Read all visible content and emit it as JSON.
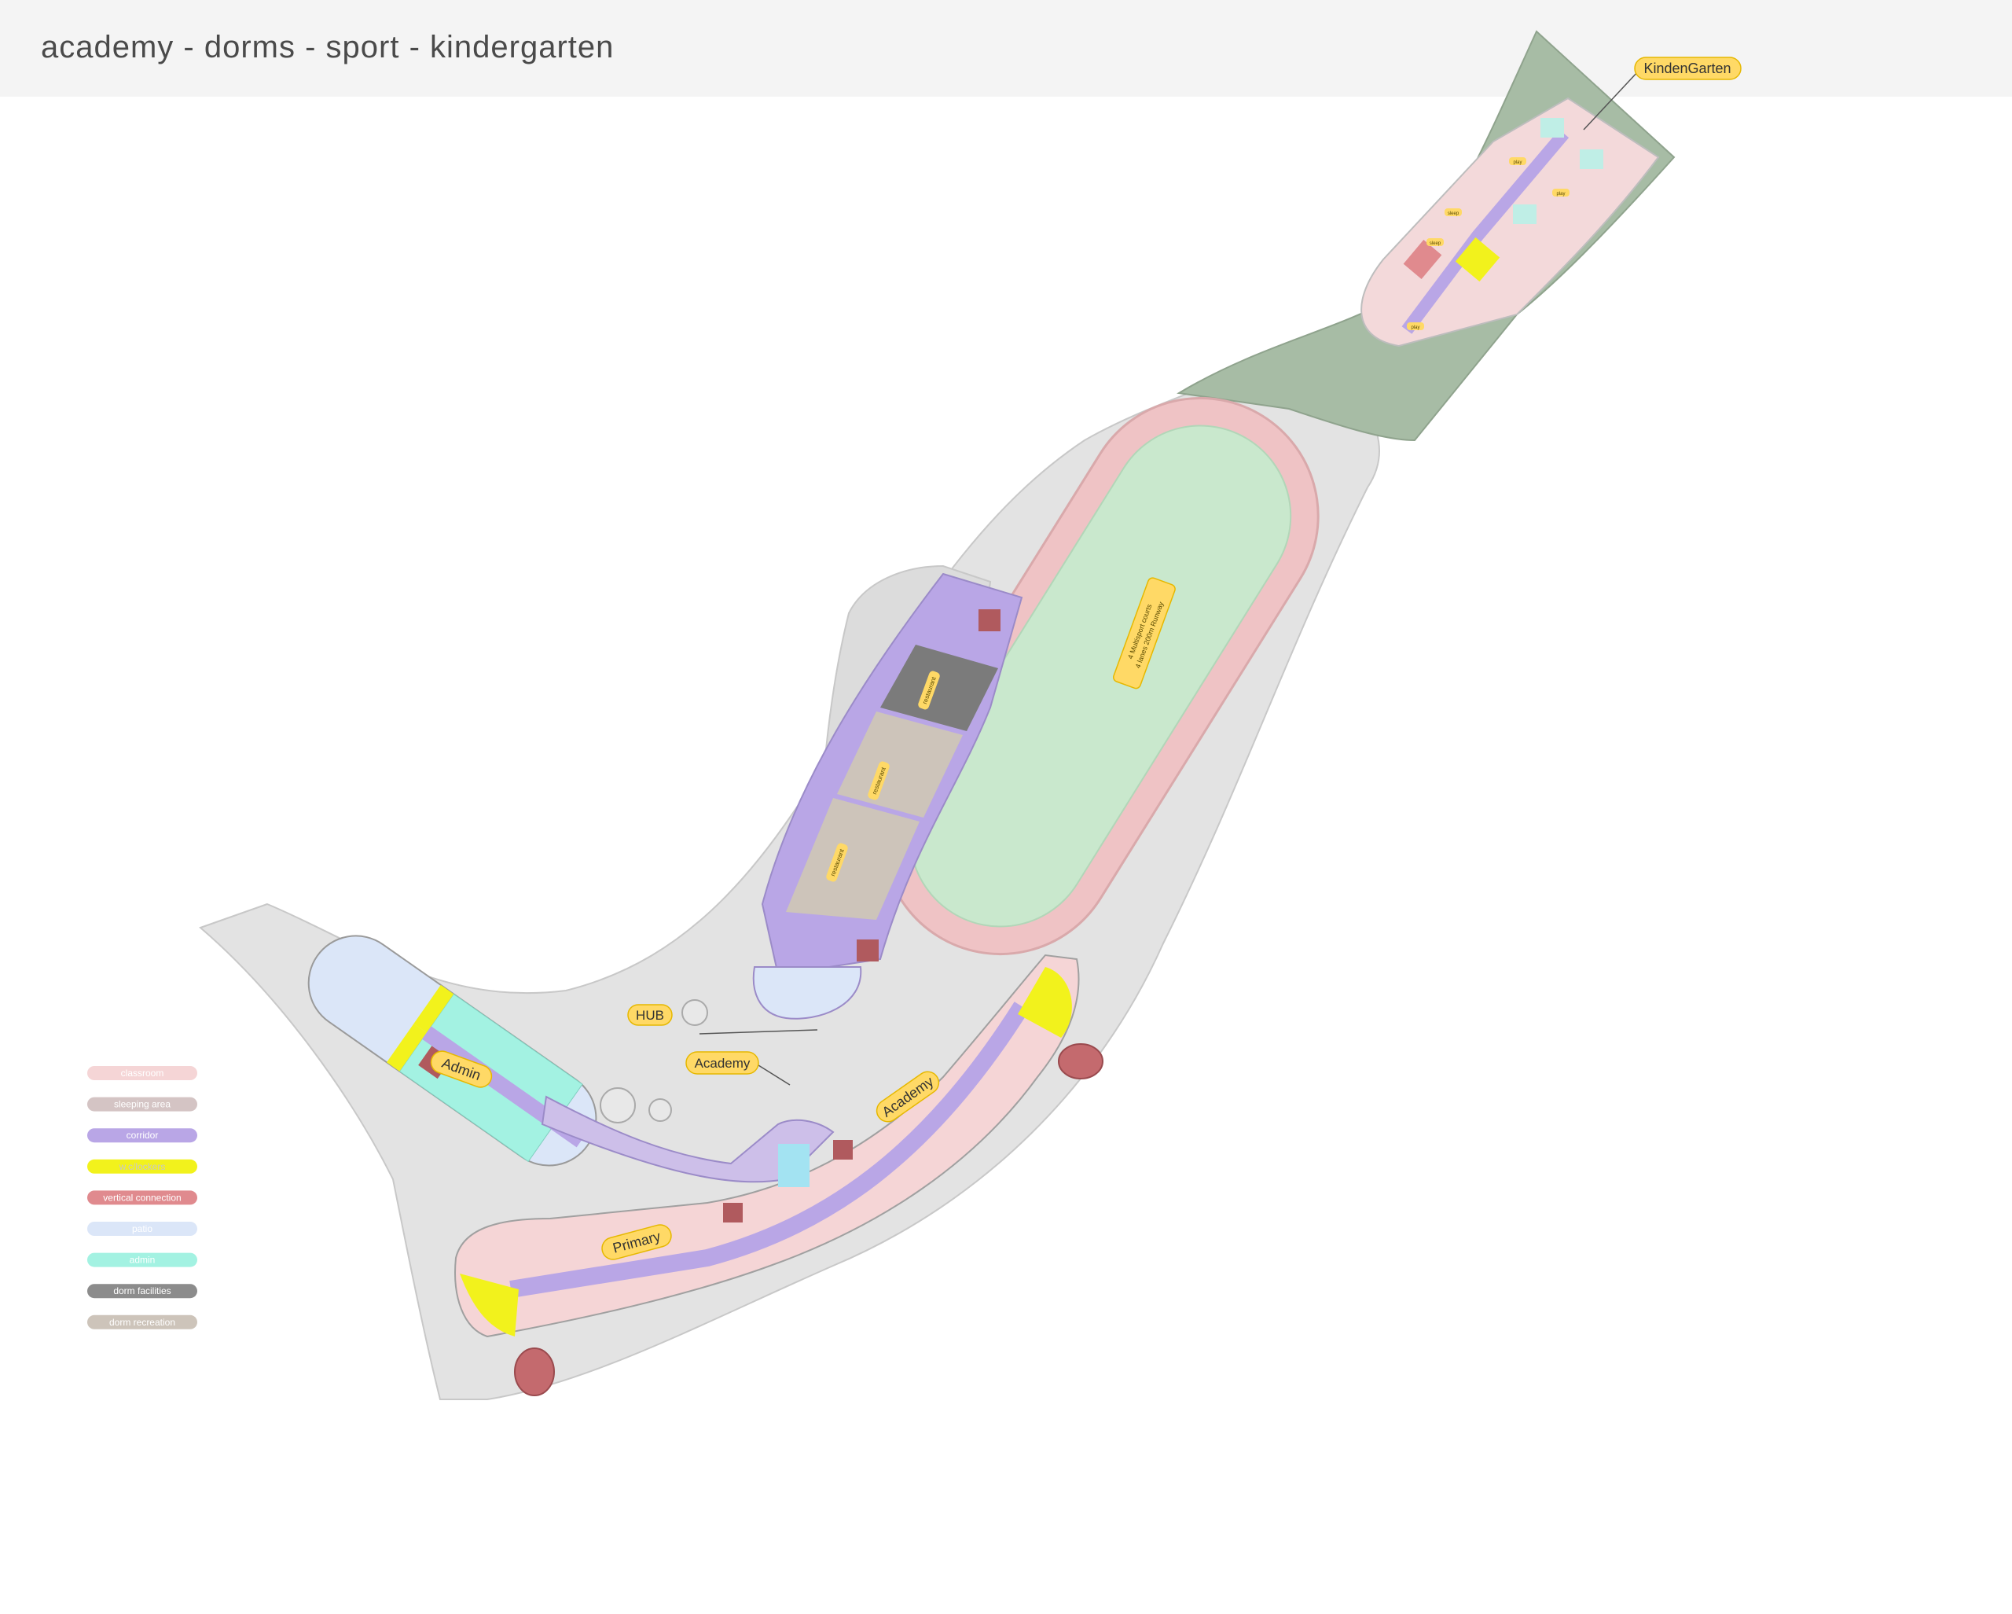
{
  "header": {
    "title": "academy - dorms - sport - kindergarten"
  },
  "labels": {
    "kindergarten": "KindenGarten",
    "hub": "HUB",
    "academy_main": "Academy",
    "academy_wing": "Academy",
    "admin": "Admin",
    "primary": "Primary",
    "restaurant": "restaurant",
    "play": "play",
    "sleep": "sleep",
    "field_line1": "4 Multisport courts",
    "field_line2": "4 lanes 200m Runway"
  },
  "legend": [
    {
      "label": "classroom",
      "color": "#f5d5d6",
      "text_color": "#ffffff"
    },
    {
      "label": "sleeping area",
      "color": "#d4c4c4",
      "text_color": "#ffffff"
    },
    {
      "label": "corridor",
      "color": "#b9a6e6",
      "text_color": "#ffffff"
    },
    {
      "label": "w.c/lockers",
      "color": "#f2f21c",
      "text_color": "#c8c8c8"
    },
    {
      "label": "vertical connection",
      "color": "#e08a8e",
      "text_color": "#ffffff"
    },
    {
      "label": "patio",
      "color": "#dbe6f8",
      "text_color": "#ffffff"
    },
    {
      "label": "admin",
      "color": "#a3f2e2",
      "text_color": "#ffffff"
    },
    {
      "label": "dorm facilities",
      "color": "#8c8c8c",
      "text_color": "#ffffff"
    },
    {
      "label": "dorm recreation",
      "color": "#cdc4ba",
      "text_color": "#ffffff"
    }
  ],
  "colors": {
    "site": "#e3e3e3",
    "green_area": "#a7bca5",
    "track": "#efc3c5",
    "field": "#c9e8cd",
    "tag_fill": "#ffd966",
    "tag_stroke": "#e6b800"
  }
}
